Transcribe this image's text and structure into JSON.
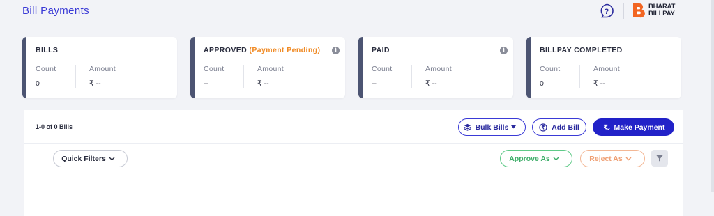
{
  "header": {
    "title": "Bill Payments",
    "brand_line1": "BHARAT",
    "brand_line2": "BILLPAY"
  },
  "cards": [
    {
      "title": "BILLS",
      "count_label": "Count",
      "count_value": "0",
      "amount_label": "Amount",
      "amount_value": "₹ --"
    },
    {
      "title": "APPROVED",
      "title_suffix": "(Payment Pending)",
      "count_label": "Count",
      "count_value": "--",
      "amount_label": "Amount",
      "amount_value": "₹ --"
    },
    {
      "title": "PAID",
      "count_label": "Count",
      "count_value": "--",
      "amount_label": "Amount",
      "amount_value": "₹ --"
    },
    {
      "title": "BILLPAY COMPLETED",
      "count_label": "Count",
      "count_value": "0",
      "amount_label": "Amount",
      "amount_value": "₹ --"
    }
  ],
  "toolbar": {
    "bill_count": "1-0 of 0 Bills",
    "bulk_bills": "Bulk Bills",
    "add_bill": "Add Bill",
    "make_payment": "Make Payment"
  },
  "filters": {
    "quick_filters": "Quick Filters",
    "approve_as": "Approve As",
    "reject_as": "Reject As"
  },
  "colors": {
    "accent": "#2222c8",
    "pending": "#f08a24",
    "approve": "#3fae6a",
    "reject": "#ef9f73",
    "brand_orange": "#f26522"
  }
}
